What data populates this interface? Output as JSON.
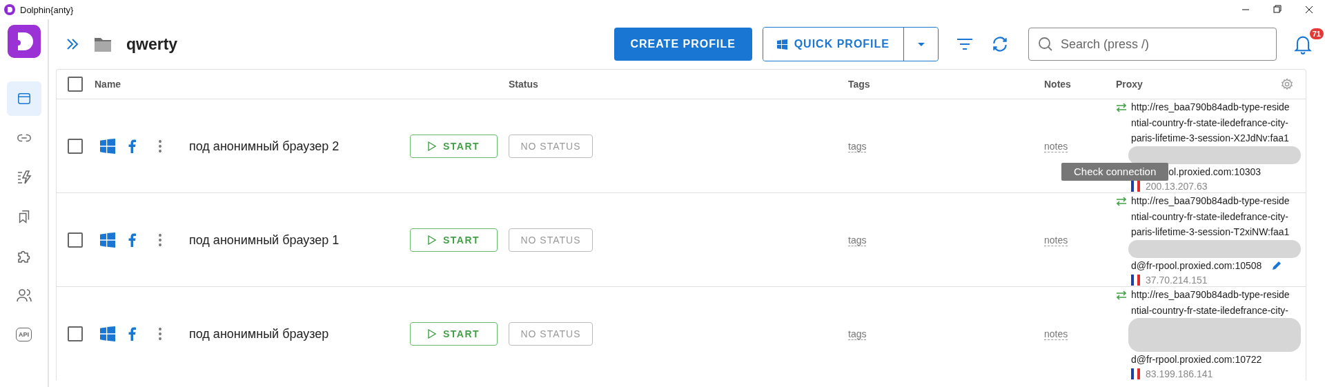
{
  "window": {
    "title": "Dolphin{anty}"
  },
  "sidebar": {
    "items": [
      {
        "kind": "browser",
        "selected": true
      },
      {
        "kind": "link",
        "selected": false
      },
      {
        "kind": "automation",
        "selected": false
      },
      {
        "kind": "bookmarks",
        "selected": false
      },
      {
        "kind": "extension",
        "selected": false
      },
      {
        "kind": "users",
        "selected": false
      },
      {
        "kind": "api",
        "label": "API",
        "selected": false
      }
    ]
  },
  "header": {
    "folder": "qwerty",
    "create_button": "CREATE PROFILE",
    "quick_button": "QUICK PROFILE",
    "search": {
      "placeholder": "Search (press /)"
    },
    "notifications": "71"
  },
  "table": {
    "select_all": {
      "checked": false
    },
    "columns": [
      "Name",
      "Status",
      "Tags",
      "Notes",
      "Proxy"
    ],
    "rows": [
      {
        "checked": false,
        "name": "под анонимный браузер 2",
        "start": "START",
        "status": "NO STATUS",
        "tags": "tags",
        "notes": "notes",
        "proxy": {
          "lines": [
            "http://res_baa790b84adb-type-reside",
            "ntial-country-fr-state-iledefrance-city-",
            "paris-lifetime-3-session-X2JdNv:faa1"
          ],
          "host": "ol.proxied.com:10303",
          "ip": "200.13.207.63",
          "tooltip": "Check connection",
          "editable": false
        }
      },
      {
        "checked": false,
        "name": "под анонимный браузер 1",
        "start": "START",
        "status": "NO STATUS",
        "tags": "tags",
        "notes": "notes",
        "proxy": {
          "lines": [
            "http://res_baa790b84adb-type-reside",
            "ntial-country-fr-state-iledefrance-city-",
            "paris-lifetime-3-session-T2xiNW:faa1"
          ],
          "host": "d@fr-rpool.proxied.com:10508",
          "ip": "37.70.214.151",
          "editable": true
        }
      },
      {
        "checked": false,
        "name": "под анонимный браузер",
        "start": "START",
        "status": "NO STATUS",
        "tags": "tags",
        "notes": "notes",
        "proxy": {
          "lines": [
            "http://res_baa790b84adb-type-reside",
            "ntial-country-fr-state-iledefrance-city-"
          ],
          "host": "d@fr-rpool.proxied.com:10722",
          "ip": "83.199.186.141",
          "editable": false
        }
      }
    ]
  }
}
